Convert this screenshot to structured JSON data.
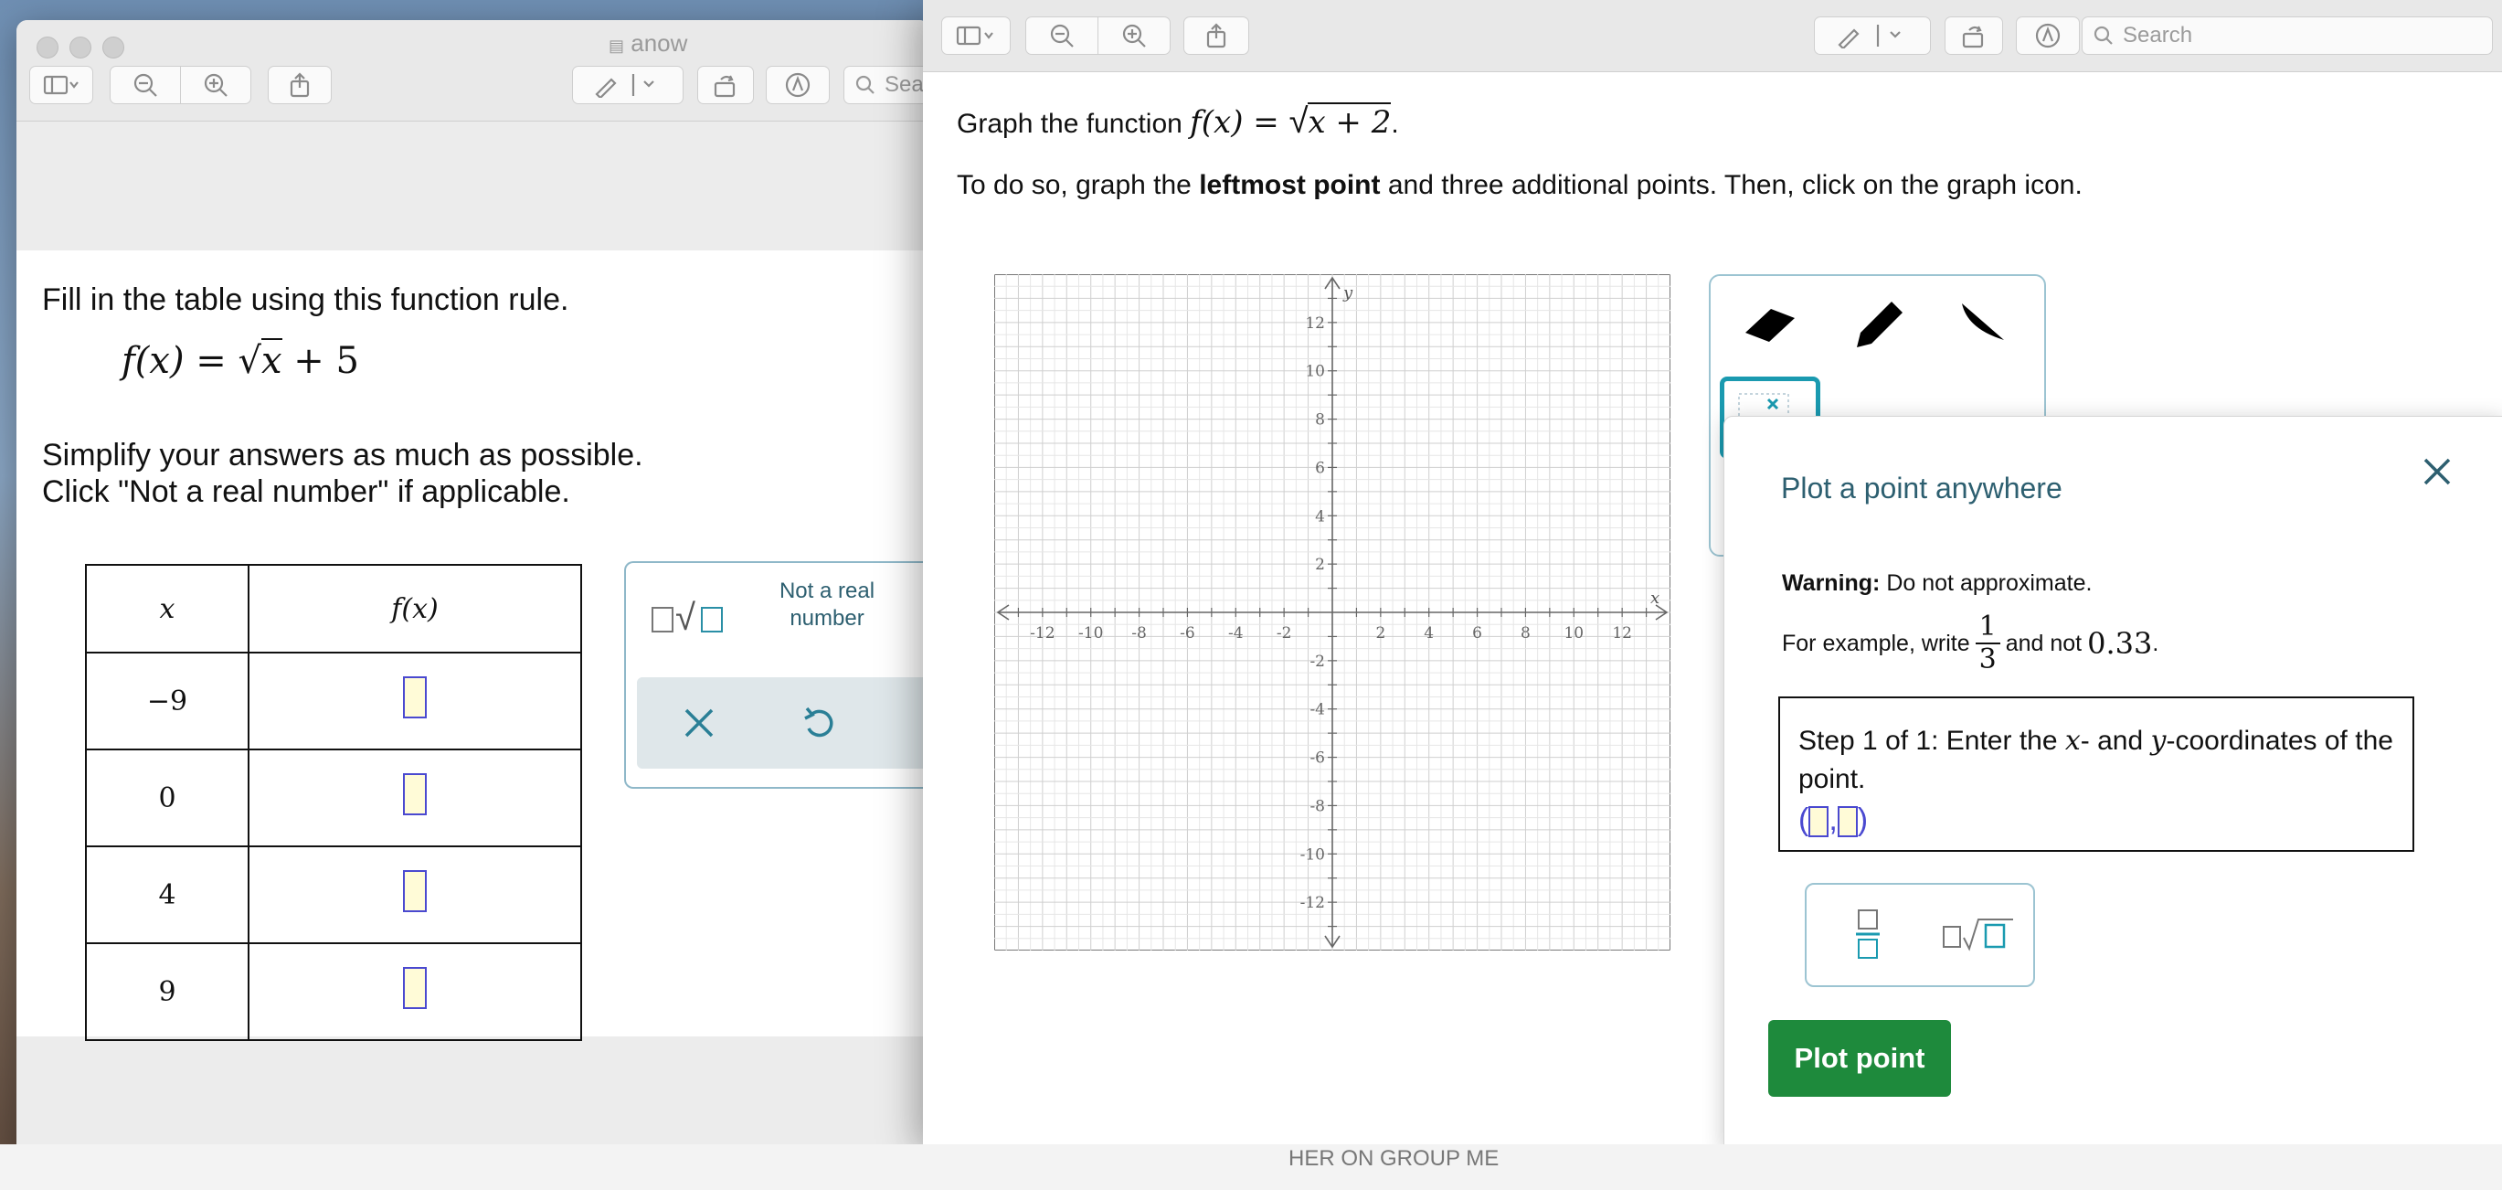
{
  "left_window": {
    "title": "anow",
    "search_placeholder": "Sea",
    "instruction": "Fill in the table using this function rule.",
    "function_rule": {
      "lhs": "f(x) = ",
      "radicand": "x",
      "rest": " + 5"
    },
    "simplify_line1": "Simplify your answers as much as possible.",
    "simplify_line2": "Click \"Not a real number\" if applicable.",
    "table": {
      "headers": [
        "x",
        "f(x)"
      ],
      "rows": [
        {
          "x": "−9"
        },
        {
          "x": "0"
        },
        {
          "x": "4"
        },
        {
          "x": "9"
        }
      ]
    },
    "palette": {
      "not_real_label": "Not a real number"
    }
  },
  "right_window": {
    "search_placeholder": "Search",
    "prompt": {
      "pre": "Graph the function ",
      "lhs": "f(x) = ",
      "radicand": "x + 2",
      "post": "."
    },
    "instructions": {
      "pre": "To do so, graph the ",
      "bold": "leftmost point",
      "post": " and three additional points. Then, click on the graph icon."
    },
    "popup": {
      "title": "Plot a point anywhere",
      "warning_label": "Warning:",
      "warning_text": " Do not approximate.",
      "example_pre": "For example, write ",
      "fraction_num": "1",
      "fraction_den": "3",
      "example_mid": " and not ",
      "example_decimal": "0.33",
      "example_end": ".",
      "step_pre": "Step 1 of 1: Enter the ",
      "step_x": "x",
      "step_mid": "- and ",
      "step_y": "y",
      "step_post": "-coordinates of the point.",
      "plot_button": "Plot point"
    }
  },
  "background": {
    "taskbar_text": "HER ON GROUP ME"
  },
  "colors": {
    "accent_teal": "#1a9ab0",
    "plot_green": "#1e8a3c",
    "answer_box_fill": "#fffbd7",
    "answer_box_border": "#4a49d0"
  },
  "chart_data": {
    "type": "scatter",
    "xlabel": "x",
    "ylabel": "y",
    "xlim": [
      -14,
      14
    ],
    "ylim": [
      -14,
      14
    ],
    "x_ticks": [
      -12,
      -10,
      -8,
      -6,
      -4,
      -2,
      2,
      4,
      6,
      8,
      10,
      12
    ],
    "y_ticks": [
      12,
      10,
      8,
      6,
      4,
      2,
      -2,
      -4,
      -6,
      -8,
      -10,
      -12
    ],
    "grid": true,
    "points": []
  }
}
